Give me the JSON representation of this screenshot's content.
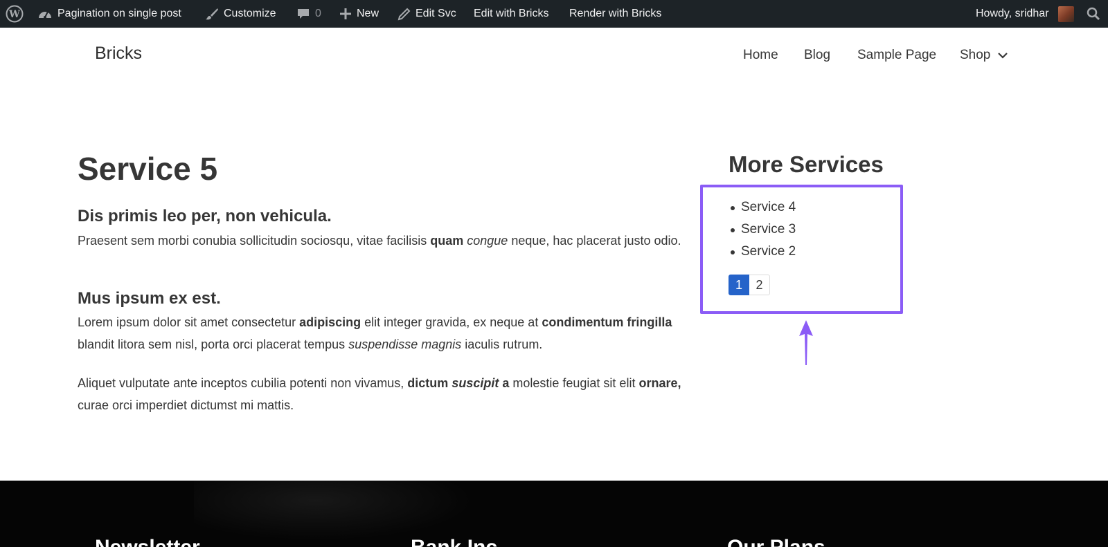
{
  "admin_bar": {
    "site_name": "Pagination on single post",
    "customize": "Customize",
    "comments_count": "0",
    "new": "New",
    "edit": "Edit Svc",
    "edit_bricks": "Edit with Bricks",
    "render_bricks": "Render with Bricks",
    "howdy": "Howdy, sridhar"
  },
  "header": {
    "logo": "Bricks",
    "nav": [
      "Home",
      "Blog",
      "Sample Page",
      "Shop"
    ]
  },
  "post": {
    "title": "Service 5",
    "heading1": "Dis primis leo per, non vehicula.",
    "heading2": "Mus ipsum ex est."
  },
  "sidebar": {
    "title": "More Services",
    "items": [
      "Service 4",
      "Service 3",
      "Service 2"
    ],
    "pages": [
      "1",
      "2"
    ],
    "current_page": "1",
    "highlight_color": "#8b5cf6"
  },
  "footer": {
    "headings": [
      "Newsletter",
      "Bank Inc.",
      "Our Plans"
    ]
  },
  "colors": {
    "admin_bar_bg": "#1d2327",
    "pagination_active": "#2563c9",
    "footer_bg": "#050505"
  }
}
